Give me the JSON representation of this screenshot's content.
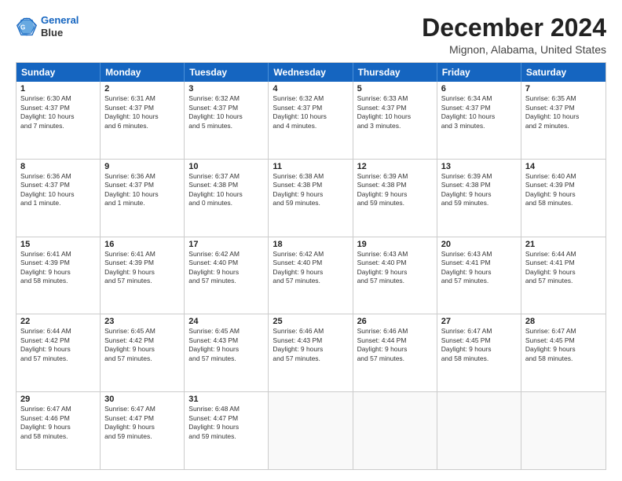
{
  "logo": {
    "line1": "General",
    "line2": "Blue"
  },
  "title": "December 2024",
  "subtitle": "Mignon, Alabama, United States",
  "header_days": [
    "Sunday",
    "Monday",
    "Tuesday",
    "Wednesday",
    "Thursday",
    "Friday",
    "Saturday"
  ],
  "weeks": [
    [
      {
        "day": "1",
        "lines": [
          "Sunrise: 6:30 AM",
          "Sunset: 4:37 PM",
          "Daylight: 10 hours",
          "and 7 minutes."
        ]
      },
      {
        "day": "2",
        "lines": [
          "Sunrise: 6:31 AM",
          "Sunset: 4:37 PM",
          "Daylight: 10 hours",
          "and 6 minutes."
        ]
      },
      {
        "day": "3",
        "lines": [
          "Sunrise: 6:32 AM",
          "Sunset: 4:37 PM",
          "Daylight: 10 hours",
          "and 5 minutes."
        ]
      },
      {
        "day": "4",
        "lines": [
          "Sunrise: 6:32 AM",
          "Sunset: 4:37 PM",
          "Daylight: 10 hours",
          "and 4 minutes."
        ]
      },
      {
        "day": "5",
        "lines": [
          "Sunrise: 6:33 AM",
          "Sunset: 4:37 PM",
          "Daylight: 10 hours",
          "and 3 minutes."
        ]
      },
      {
        "day": "6",
        "lines": [
          "Sunrise: 6:34 AM",
          "Sunset: 4:37 PM",
          "Daylight: 10 hours",
          "and 3 minutes."
        ]
      },
      {
        "day": "7",
        "lines": [
          "Sunrise: 6:35 AM",
          "Sunset: 4:37 PM",
          "Daylight: 10 hours",
          "and 2 minutes."
        ]
      }
    ],
    [
      {
        "day": "8",
        "lines": [
          "Sunrise: 6:36 AM",
          "Sunset: 4:37 PM",
          "Daylight: 10 hours",
          "and 1 minute."
        ]
      },
      {
        "day": "9",
        "lines": [
          "Sunrise: 6:36 AM",
          "Sunset: 4:37 PM",
          "Daylight: 10 hours",
          "and 1 minute."
        ]
      },
      {
        "day": "10",
        "lines": [
          "Sunrise: 6:37 AM",
          "Sunset: 4:38 PM",
          "Daylight: 10 hours",
          "and 0 minutes."
        ]
      },
      {
        "day": "11",
        "lines": [
          "Sunrise: 6:38 AM",
          "Sunset: 4:38 PM",
          "Daylight: 9 hours",
          "and 59 minutes."
        ]
      },
      {
        "day": "12",
        "lines": [
          "Sunrise: 6:39 AM",
          "Sunset: 4:38 PM",
          "Daylight: 9 hours",
          "and 59 minutes."
        ]
      },
      {
        "day": "13",
        "lines": [
          "Sunrise: 6:39 AM",
          "Sunset: 4:38 PM",
          "Daylight: 9 hours",
          "and 59 minutes."
        ]
      },
      {
        "day": "14",
        "lines": [
          "Sunrise: 6:40 AM",
          "Sunset: 4:39 PM",
          "Daylight: 9 hours",
          "and 58 minutes."
        ]
      }
    ],
    [
      {
        "day": "15",
        "lines": [
          "Sunrise: 6:41 AM",
          "Sunset: 4:39 PM",
          "Daylight: 9 hours",
          "and 58 minutes."
        ]
      },
      {
        "day": "16",
        "lines": [
          "Sunrise: 6:41 AM",
          "Sunset: 4:39 PM",
          "Daylight: 9 hours",
          "and 57 minutes."
        ]
      },
      {
        "day": "17",
        "lines": [
          "Sunrise: 6:42 AM",
          "Sunset: 4:40 PM",
          "Daylight: 9 hours",
          "and 57 minutes."
        ]
      },
      {
        "day": "18",
        "lines": [
          "Sunrise: 6:42 AM",
          "Sunset: 4:40 PM",
          "Daylight: 9 hours",
          "and 57 minutes."
        ]
      },
      {
        "day": "19",
        "lines": [
          "Sunrise: 6:43 AM",
          "Sunset: 4:40 PM",
          "Daylight: 9 hours",
          "and 57 minutes."
        ]
      },
      {
        "day": "20",
        "lines": [
          "Sunrise: 6:43 AM",
          "Sunset: 4:41 PM",
          "Daylight: 9 hours",
          "and 57 minutes."
        ]
      },
      {
        "day": "21",
        "lines": [
          "Sunrise: 6:44 AM",
          "Sunset: 4:41 PM",
          "Daylight: 9 hours",
          "and 57 minutes."
        ]
      }
    ],
    [
      {
        "day": "22",
        "lines": [
          "Sunrise: 6:44 AM",
          "Sunset: 4:42 PM",
          "Daylight: 9 hours",
          "and 57 minutes."
        ]
      },
      {
        "day": "23",
        "lines": [
          "Sunrise: 6:45 AM",
          "Sunset: 4:42 PM",
          "Daylight: 9 hours",
          "and 57 minutes."
        ]
      },
      {
        "day": "24",
        "lines": [
          "Sunrise: 6:45 AM",
          "Sunset: 4:43 PM",
          "Daylight: 9 hours",
          "and 57 minutes."
        ]
      },
      {
        "day": "25",
        "lines": [
          "Sunrise: 6:46 AM",
          "Sunset: 4:43 PM",
          "Daylight: 9 hours",
          "and 57 minutes."
        ]
      },
      {
        "day": "26",
        "lines": [
          "Sunrise: 6:46 AM",
          "Sunset: 4:44 PM",
          "Daylight: 9 hours",
          "and 57 minutes."
        ]
      },
      {
        "day": "27",
        "lines": [
          "Sunrise: 6:47 AM",
          "Sunset: 4:45 PM",
          "Daylight: 9 hours",
          "and 58 minutes."
        ]
      },
      {
        "day": "28",
        "lines": [
          "Sunrise: 6:47 AM",
          "Sunset: 4:45 PM",
          "Daylight: 9 hours",
          "and 58 minutes."
        ]
      }
    ],
    [
      {
        "day": "29",
        "lines": [
          "Sunrise: 6:47 AM",
          "Sunset: 4:46 PM",
          "Daylight: 9 hours",
          "and 58 minutes."
        ]
      },
      {
        "day": "30",
        "lines": [
          "Sunrise: 6:47 AM",
          "Sunset: 4:47 PM",
          "Daylight: 9 hours",
          "and 59 minutes."
        ]
      },
      {
        "day": "31",
        "lines": [
          "Sunrise: 6:48 AM",
          "Sunset: 4:47 PM",
          "Daylight: 9 hours",
          "and 59 minutes."
        ]
      },
      {
        "day": "",
        "lines": []
      },
      {
        "day": "",
        "lines": []
      },
      {
        "day": "",
        "lines": []
      },
      {
        "day": "",
        "lines": []
      }
    ]
  ]
}
